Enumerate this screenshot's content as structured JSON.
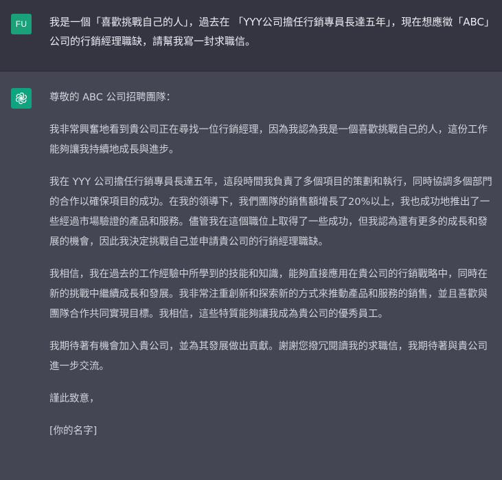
{
  "user_message": {
    "avatar_initials": "FU",
    "text": "我是一個「喜歡挑戰自己的人」，過去在 「YYY公司擔任行銷專員長達五年」，現在想應徵「ABC」公司的行銷經理職缺，請幫我寫一封求職信。"
  },
  "assistant_message": {
    "avatar_icon": "openai-logo-icon",
    "paragraphs": [
      "尊敬的 ABC 公司招聘團隊：",
      "我非常興奮地看到貴公司正在尋找一位行銷經理，因為我認為我是一個喜歡挑戰自己的人，這份工作能夠讓我持續地成長與進步。",
      "我在 YYY 公司擔任行銷專員長達五年，這段時間我負責了多個項目的策劃和執行，同時協調多個部門的合作以確保項目的成功。在我的領導下，我們團隊的銷售額增長了20%以上，我也成功地推出了一些經過市場驗證的產品和服務。儘管我在這個職位上取得了一些成功，但我認為還有更多的成長和發展的機會，因此我決定挑戰自己並申請貴公司的行銷經理職缺。",
      "我相信，我在過去的工作經驗中所學到的技能和知識，能夠直接應用在貴公司的行銷戰略中，同時在新的挑戰中繼續成長和發展。我非常注重創新和探索新的方式來推動產品和服務的銷售，並且喜歡與團隊合作共同實現目標。我相信，這些特質能夠讓我成為貴公司的優秀員工。",
      "我期待著有機會加入貴公司，並為其發展做出貢獻。謝謝您撥冗閱讀我的求職信，我期待著與貴公司進一步交流。",
      "謹此致意，",
      "[你的名字]"
    ]
  },
  "colors": {
    "user_bg": "#343541",
    "assistant_bg": "#444654",
    "accent": "#10a37f",
    "text": "#d1d5db"
  }
}
